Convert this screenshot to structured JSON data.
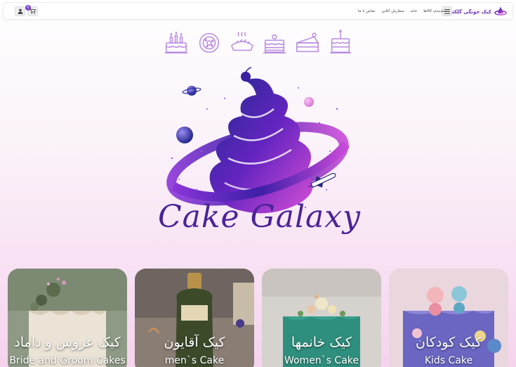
{
  "header": {
    "brand_name": "کیک خونگی گلکسی",
    "nav": [
      "دسته‌بندی کالاها",
      "خانه",
      "سفارش آنلاین",
      "تماس با ما"
    ],
    "cart_count": "0"
  },
  "category_icons": [
    "birthday-cake-icon",
    "tart-icon",
    "pie-icon",
    "layer-cake-icon",
    "cake-slice-icon",
    "tall-cake-icon"
  ],
  "hero": {
    "title": "Cake Galaxy"
  },
  "categories": [
    {
      "title_fa": "کیک عروس و داماد",
      "title_en": "Bride and Groom Cakes"
    },
    {
      "title_fa": "کیک آقایون",
      "title_en": "men`s Cake"
    },
    {
      "title_fa": "کیک خانمها",
      "title_en": "Women`s Cake"
    },
    {
      "title_fa": "کیک کودکان",
      "title_en": "Kids Cake"
    }
  ],
  "colors": {
    "brand": "#6a2bb8",
    "icon_purple": "#b98ce0",
    "title_purple": "#4a2398",
    "badge": "#7d3cc9"
  }
}
